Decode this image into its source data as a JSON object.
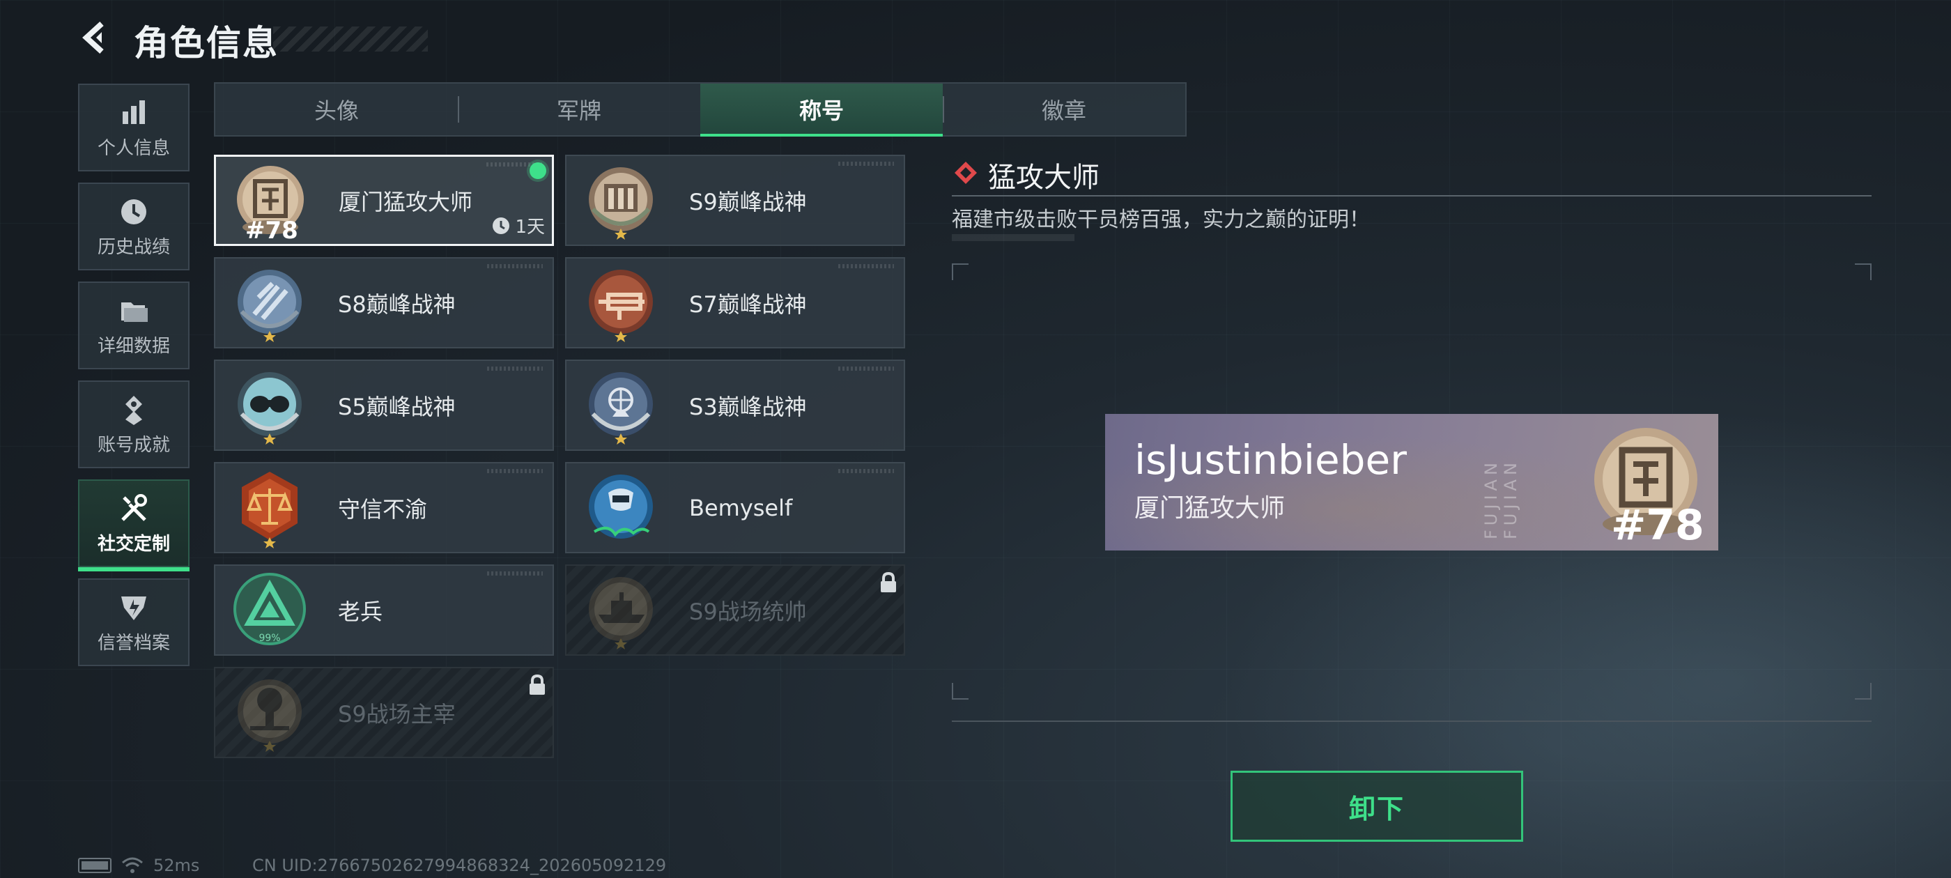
{
  "header": {
    "title": "角色信息"
  },
  "sidebar": {
    "items": [
      {
        "label": "个人信息",
        "icon": "bar-chart-icon"
      },
      {
        "label": "历史战绩",
        "icon": "clock-icon"
      },
      {
        "label": "详细数据",
        "icon": "folder-icon"
      },
      {
        "label": "账号成就",
        "icon": "achievement-icon"
      },
      {
        "label": "社交定制",
        "icon": "tools-icon",
        "active": true
      },
      {
        "label": "信誉档案",
        "icon": "shield-icon"
      }
    ]
  },
  "tabs": [
    {
      "label": "头像"
    },
    {
      "label": "军牌"
    },
    {
      "label": "称号",
      "active": true
    },
    {
      "label": "徽章"
    }
  ],
  "titles": [
    {
      "name": "厦门猛攻大师",
      "rank": "78",
      "timer": "1天",
      "selected": true,
      "equipped": true
    },
    {
      "name": "S9巅峰战神"
    },
    {
      "name": "S8巅峰战神"
    },
    {
      "name": "S7巅峰战神"
    },
    {
      "name": "S5巅峰战神"
    },
    {
      "name": "S3巅峰战神"
    },
    {
      "name": "守信不渝"
    },
    {
      "name": "Bemyself"
    },
    {
      "name": "老兵",
      "badge_text": "99%"
    },
    {
      "name": "S9战场统帅",
      "locked": true
    },
    {
      "name": "S9战场主宰",
      "locked": true
    }
  ],
  "detail": {
    "title": "猛攻大师",
    "description": "福建市级击败干员榜百强，实力之巅的证明！"
  },
  "preview": {
    "player": "isJustinbieber",
    "title": "厦门猛攻大师",
    "province": "FUJIAN FUJIAN",
    "rank": "78"
  },
  "actions": {
    "unequip": "卸下"
  },
  "status": {
    "ping": "52ms",
    "uid": "CN UID:27667502627994868324_202605092129"
  },
  "colors": {
    "accent": "#3ee08a",
    "diamond": "#e0494b"
  }
}
